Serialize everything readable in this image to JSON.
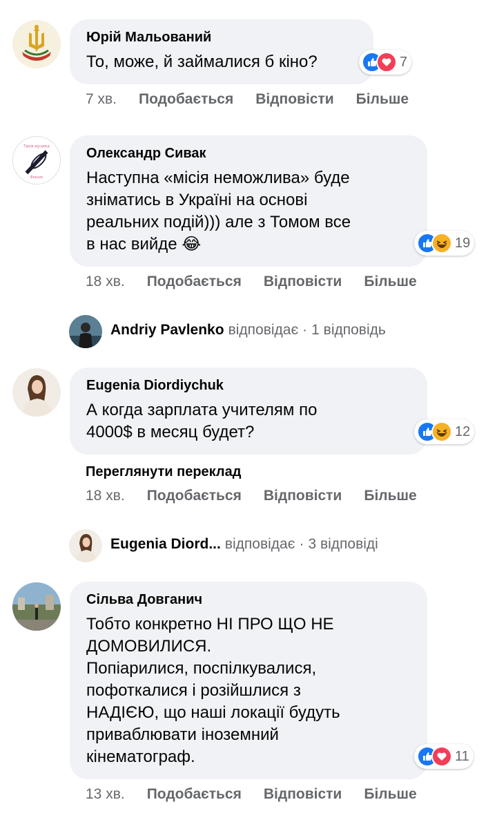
{
  "colors": {
    "like": "#1877f2",
    "love": "#f33e58",
    "haha": "#f7b125",
    "bubble": "#f0f2f5",
    "meta": "#65676b"
  },
  "actions": {
    "like": "Подобається",
    "reply": "Відповісти",
    "more": "Більше"
  },
  "comments": [
    {
      "author": "Юрій Мальований",
      "text": "То, може, й займалися б кіно?",
      "time": "7 хв.",
      "reactions": [
        "like-icon",
        "love-icon"
      ],
      "reaction_count": "7"
    },
    {
      "author": "Олександр Сивак",
      "text": "Наступна «місія неможлива» буде\nзніматись в Україні на основі\nреальних подій))) але з Томом все\nв нас вийде 😂",
      "time": "18 хв.",
      "reactions": [
        "like-icon",
        "haha-icon"
      ],
      "reaction_count": "19",
      "reply": {
        "author": "Andriy Pavlenko",
        "verb": "відповідає",
        "sep": "·",
        "count": "1 відповідь"
      }
    },
    {
      "author": "Eugenia Diordiychuk",
      "text": "А когда зарплата учителям по\n4000$ в месяц будет?",
      "time": "18 хв.",
      "reactions": [
        "like-icon",
        "haha-icon"
      ],
      "reaction_count": "12",
      "translate": "Переглянути переклад",
      "reply": {
        "author": "Eugenia Diord...",
        "verb": "відповідає",
        "sep": "·",
        "count": "3 відповіді"
      }
    },
    {
      "author": "Сільва Довганич",
      "text": "Тобто конкретно НІ ПРО ЩО НЕ\nДОМОВИЛИСЯ.\nПопіарилися, поспілкувалися,\nпофоткалися і розійшлися з\nНАДІЄЮ, що наші локації будуть\nприваблювати іноземний\nкінематограф.",
      "time": "13 хв.",
      "reactions": [
        "like-icon",
        "love-icon"
      ],
      "reaction_count": "11"
    }
  ]
}
